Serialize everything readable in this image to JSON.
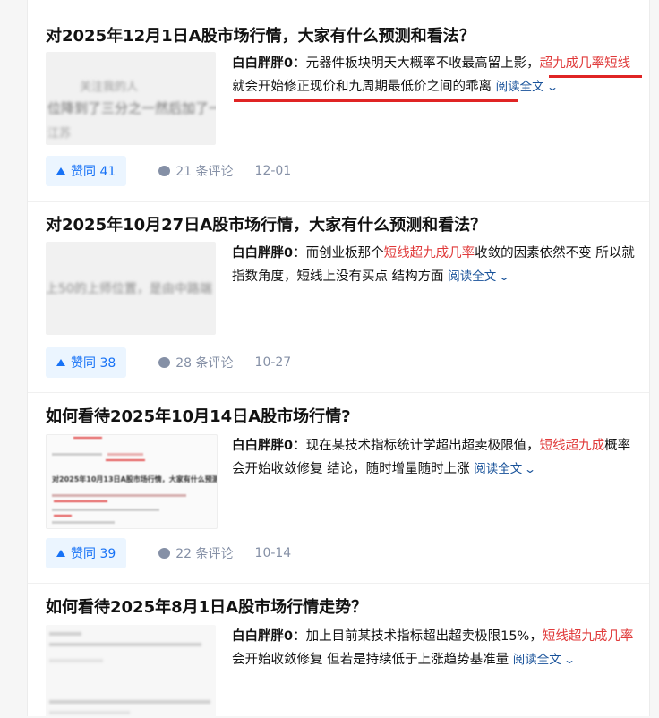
{
  "feed": {
    "items": [
      {
        "title": "对2025年12月1日A股市场行情，大家有什么预测和看法？",
        "author": "白白胖胖0",
        "text_before": "元器件板块明天大概率不收最高留上影，",
        "highlight": "超九成几率短线",
        "text_after": "就会开始修正现价和九周期最低价之间的乖离",
        "read_more": "阅读全文",
        "votes": "赞同 41",
        "comments": "21 条评论",
        "date": "12-01",
        "thumb_text": [
          "关注我的人",
          "位降到了三分之一然后加了一",
          "江苏"
        ]
      },
      {
        "title": "对2025年10月27日A股市场行情，大家有什么预测和看法？",
        "author": "白白胖胖0",
        "text_before": "而创业板那个",
        "highlight": "短线超九成几率",
        "text_after": "收敛的因素依然不变 所以就指数角度，短线上没有买点 结构方面",
        "read_more": "阅读全文",
        "votes": "赞同 38",
        "comments": "28 条评论",
        "date": "10-27",
        "thumb_text": [
          "上50的上师位置，是由中路端"
        ]
      },
      {
        "title": "如何看待2025年10月14日A股市场行情?",
        "author": "白白胖胖0",
        "text_before": "现在某技术指标统计学超出超卖极限值，",
        "highlight": "短线超九成",
        "text_after": "概率会开始收敛修复 结论，随时增量随时上涨",
        "read_more": "阅读全文",
        "votes": "赞同 39",
        "comments": "22 条评论",
        "date": "10-14",
        "thumb_text": [
          "对2025年10月13日A股市场行情，大家有什么预测和看法？"
        ]
      },
      {
        "title": "如何看待2025年8月1日A股市场行情走势？",
        "author": "白白胖胖0",
        "text_before": "加上目前某技术指标超出超卖极限15%，",
        "highlight": "短线超九成几率",
        "text_after": "会开始收敛修复 但若是持续低于上涨趋势基准量",
        "read_more": "阅读全文",
        "votes": "",
        "comments": "",
        "date": "",
        "thumb_text": []
      }
    ]
  },
  "colors": {
    "highlight": "#e03a3a",
    "link": "#175199",
    "vote_bg": "#ebf5ff",
    "vote_fg": "#1772f6",
    "underline": "#e02424"
  },
  "icons": {
    "vote": "triangle-up-icon",
    "comment": "comment-bubble-icon",
    "read_more": "chevron-down-icon"
  }
}
